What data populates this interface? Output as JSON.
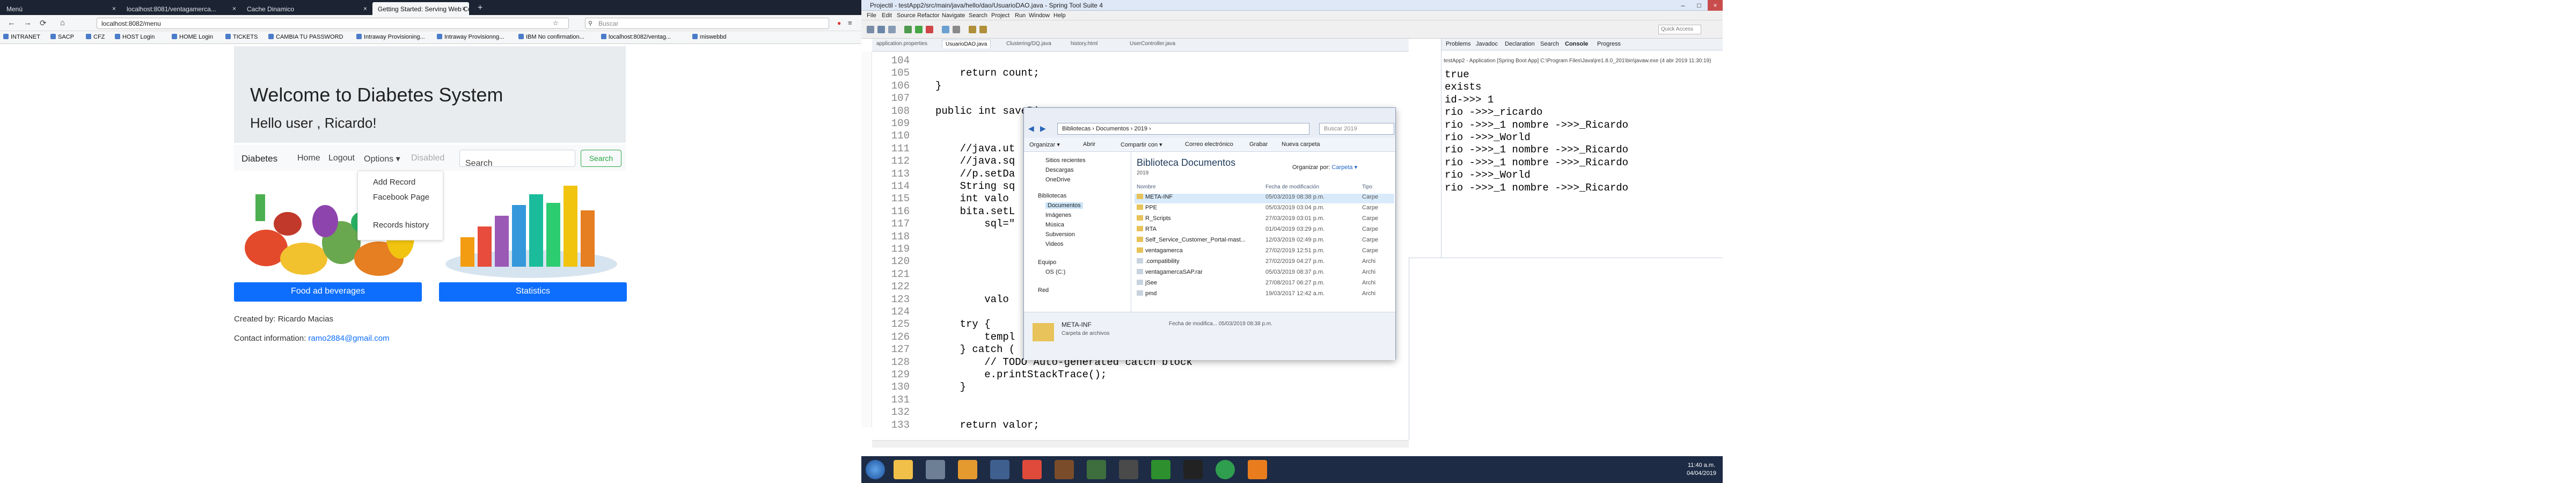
{
  "browser": {
    "tabs": [
      "Menú",
      "localhost:8081/ventagamerca...",
      "Cache Dinamico",
      "Getting Started: Serving Web Co..."
    ],
    "url": "localhost:8082/menu",
    "search_placeholder": "Buscar",
    "bookmarks": [
      "INTRANET",
      "SACP",
      "CFZ",
      "HOST Login",
      "HOME Login",
      "TICKETS",
      "CAMBIA TU PASSWORD",
      "Intraway Provisioning...",
      "Intraway Provisionng...",
      "IBM No confirmation...",
      "localhost:8082/ventag...",
      "miswebbd"
    ],
    "welcome_title": "Welcome to Diabetes System",
    "welcome_sub": "Hello user , Ricardo!",
    "nav": {
      "brand": "Diabetes",
      "home": "Home",
      "logout": "Logout",
      "options": "Options ▾",
      "disabled": "Disabled"
    },
    "search_placeholder_app": "Search",
    "search_button": "Search",
    "dropdown_items": [
      "Add Record",
      "Facebook Page",
      "Records history"
    ],
    "btn_food": "Food ad beverages",
    "btn_stats": "Statistics",
    "created_by": "Created by: Ricardo Macias",
    "contact_label": "Contact information: ",
    "contact_email": "ramo2884@gmail.com"
  },
  "ide": {
    "title": "Projectil - testApp2/src/main/java/hello/dao/UsuarioDAO.java - Spring Tool Suite 4",
    "menus": [
      "File",
      "Edit",
      "Source",
      "Refactor",
      "Navigate",
      "Search",
      "Project",
      "Run",
      "Window",
      "Help"
    ],
    "quick_access": "Quick Access",
    "editor_tabs": [
      "application.properties",
      "UsuarioDAO.java",
      "Clustering/DQ.java",
      "history.html",
      "UserController.java"
    ],
    "line_numbers": [
      "104",
      "105",
      "106",
      "107",
      "108",
      "109",
      "110",
      "111",
      "112",
      "113",
      "114",
      "115",
      "116",
      "117",
      "118",
      "119",
      "120",
      "121",
      "122",
      "123",
      "124",
      "125",
      "126",
      "127",
      "128",
      "129",
      "130",
      "131",
      "132",
      "133"
    ],
    "code_lines": [
      "",
      "    return count;",
      "}",
      "",
      "public int saveBi",
      "",
      "",
      "    //java.ut",
      "    //java.sq",
      "    //p.setDa",
      "    String sq",
      "    int valo",
      "    bita.setL",
      "        sql=\"",
      "",
      "",
      "",
      "",
      "",
      "        valo",
      "",
      "    try {",
      "        templ",
      "    } catch (",
      "        // TODO Auto-generated catch block",
      "        e.printStackTrace();",
      "    }",
      "",
      "",
      "    return valor;"
    ],
    "console_tabs": [
      "Problems",
      "Javadoc",
      "Declaration",
      "Search",
      "Console",
      "Progress"
    ],
    "console_info": "testApp2 - Application [Spring Boot App] C:\\Program Files\\Java\\jre1.8.0_201\\bin\\javaw.exe (4 abr 2019 11:30:19)",
    "console_lines": [
      "true",
      "exists",
      "id->>> 1",
      "rio ->>>_ricardo",
      "rio ->>>_1 nombre ->>>_Ricardo",
      "rio ->>>_World",
      "rio ->>>_1 nombre ->>>_Ricardo",
      "rio ->>>_1 nombre ->>>_Ricardo",
      "rio ->>>_World",
      "rio ->>>_1 nombre ->>>_Ricardo"
    ],
    "clock_time": "11:40 a.m.",
    "clock_date": "04/04/2019"
  },
  "explorer": {
    "address": "Bibliotecas › Documentos › 2019 ›",
    "search": "Buscar 2019",
    "toolbar": [
      "Organizar ▾",
      "Abrir",
      "Compartir con ▾",
      "Correo electrónico",
      "Grabar",
      "Nueva carpeta"
    ],
    "nav_items": [
      "Sitios recientes",
      "Descargas",
      "OneDrive",
      "Bibliotecas",
      "Documentos",
      "Imágenes",
      "Música",
      "Subversion",
      "Videos",
      "Equipo",
      "OS (C:)",
      "Red"
    ],
    "library_title": "Biblioteca Documentos",
    "library_sub": "2019",
    "arrange_label": "Organizar por:",
    "arrange_value": "Carpeta ▾",
    "col_name": "Nombre",
    "col_date": "Fecha de modificación",
    "col_type": "Tipo",
    "files": [
      {
        "name": "META-INF",
        "date": "05/03/2019 08:38 p.m.",
        "type": "Carpe"
      },
      {
        "name": "PPE",
        "date": "05/03/2019 03:04 p.m.",
        "type": "Carpe"
      },
      {
        "name": "R_Scripts",
        "date": "27/03/2019 03:01 p.m.",
        "type": "Carpe"
      },
      {
        "name": "RTA",
        "date": "01/04/2019 03:29 p.m.",
        "type": "Carpe"
      },
      {
        "name": "Self_Service_Customer_Portal-mast...",
        "date": "12/03/2019 02:49 p.m.",
        "type": "Carpe"
      },
      {
        "name": "ventagamerca",
        "date": "27/02/2019 12:51 p.m.",
        "type": "Carpe"
      },
      {
        "name": ".compatibility",
        "date": "27/02/2019 04:27 p.m.",
        "type": "Archi"
      },
      {
        "name": "ventagamercaSAP.rar",
        "date": "05/03/2019 08:37 p.m.",
        "type": "Archi"
      },
      {
        "name": "jSee",
        "date": "27/08/2017 06:27 p.m.",
        "type": "Archi"
      },
      {
        "name": "pmd",
        "date": "19/03/2017 12:42 a.m.",
        "type": "Archi"
      }
    ],
    "detail_name": "META-INF",
    "detail_type": "Carpeta de archivos",
    "detail_date": "Fecha de modifica... 05/03/2019 08:38 p.m."
  }
}
